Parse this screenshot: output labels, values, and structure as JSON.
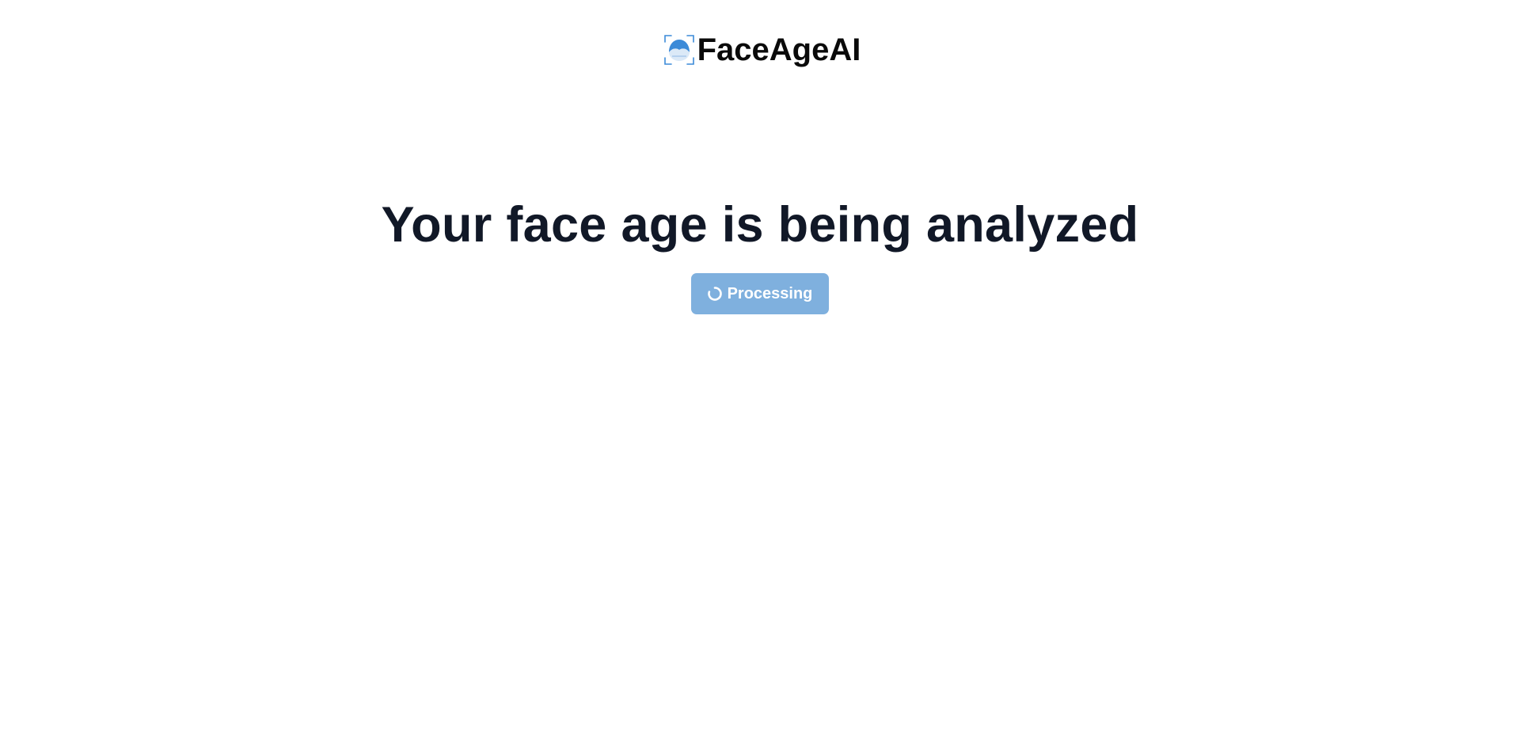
{
  "header": {
    "brand_name": "FaceAgeAI",
    "logo_icon": "face-scan-icon"
  },
  "main": {
    "headline": "Your face age is being analyzed",
    "status_button": {
      "label": "Processing",
      "icon": "spinner-icon",
      "state": "disabled"
    }
  },
  "colors": {
    "accent": "#3b8ad8",
    "button_background": "#7fb0de",
    "text_primary": "#111827",
    "background": "#ffffff"
  }
}
